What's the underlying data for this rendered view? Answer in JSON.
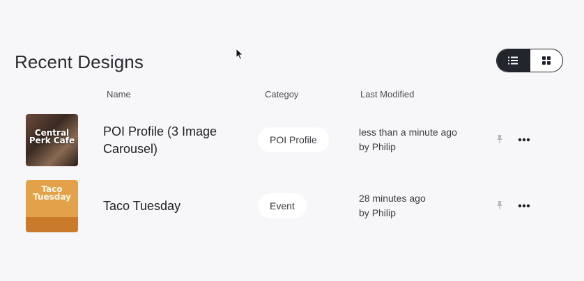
{
  "page": {
    "title": "Recent Designs"
  },
  "view_toggle": {
    "list_icon": "list-icon",
    "grid_icon": "grid-icon",
    "active": "list"
  },
  "table": {
    "headers": {
      "name": "Name",
      "category": "Categoy",
      "modified": "Last Modified"
    },
    "rows": [
      {
        "thumb_text": "Central Perk Cafe",
        "name": "POI Profile (3 Image Carousel)",
        "category": "POI Profile",
        "modified_time": "less than a minute ago",
        "modified_by_prefix": "by",
        "modified_by": "Philip"
      },
      {
        "thumb_text": "Taco Tuesday",
        "name": "Taco Tuesday",
        "category": "Event",
        "modified_time": "28 minutes ago",
        "modified_by_prefix": "by",
        "modified_by": "Philip"
      }
    ]
  },
  "colors": {
    "background": "#f7f7f9",
    "toggle_active": "#22252c",
    "pin": "#b8b8be"
  }
}
